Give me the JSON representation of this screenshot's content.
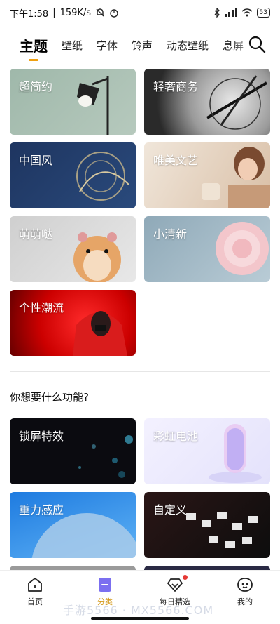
{
  "status_bar": {
    "time": "下午1:58",
    "speed": "159K/s",
    "battery": "53"
  },
  "tabs": [
    {
      "label": "主题",
      "active": true
    },
    {
      "label": "壁纸"
    },
    {
      "label": "字体"
    },
    {
      "label": "铃声"
    },
    {
      "label": "动态壁纸"
    },
    {
      "label": "息屏"
    }
  ],
  "categories": [
    {
      "label": "超简约"
    },
    {
      "label": "轻奢商务"
    },
    {
      "label": "中国风"
    },
    {
      "label": "唯美文艺"
    },
    {
      "label": "萌萌哒"
    },
    {
      "label": "小清新"
    },
    {
      "label": "个性潮流"
    }
  ],
  "section": {
    "title": "你想要什么功能?"
  },
  "features": [
    {
      "label": "锁屏特效"
    },
    {
      "label": "彩虹电池"
    },
    {
      "label": "重力感应"
    },
    {
      "label": "自定义"
    }
  ],
  "bottom_nav": [
    {
      "label": "首页",
      "icon": "home-icon"
    },
    {
      "label": "分类",
      "icon": "category-icon",
      "active": true
    },
    {
      "label": "每日精选",
      "icon": "diamond-icon",
      "badge": true
    },
    {
      "label": "我的",
      "icon": "profile-icon"
    }
  ],
  "watermark": "手游5566 · MX5566.COM",
  "colors": {
    "accent": "#d49a1c",
    "tab_indicator": "#f0a010",
    "badge": "#e53935"
  }
}
